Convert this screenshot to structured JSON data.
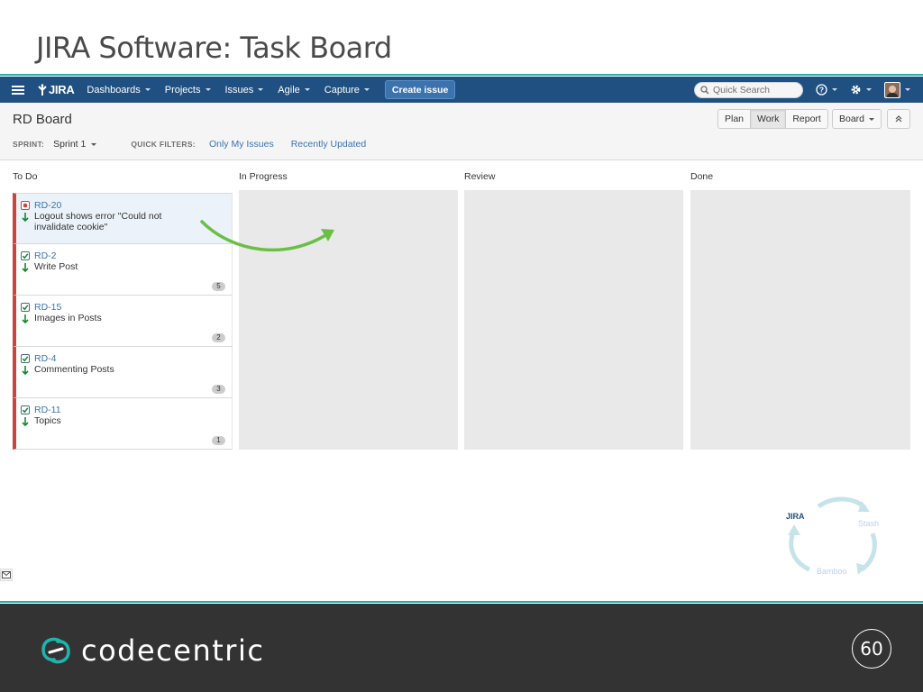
{
  "slide": {
    "title": "JIRA Software: Task Board",
    "page_number": "60",
    "footer_brand": "codecentric"
  },
  "nav": {
    "logo": "JIRA",
    "menu": [
      {
        "label": "Dashboards"
      },
      {
        "label": "Projects"
      },
      {
        "label": "Issues"
      },
      {
        "label": "Agile"
      },
      {
        "label": "Capture"
      }
    ],
    "create_label": "Create issue",
    "search_placeholder": "Quick Search"
  },
  "board": {
    "title": "RD Board",
    "sprint_label": "SPRINT:",
    "sprint_value": "Sprint 1",
    "quick_filters_label": "QUICK FILTERS:",
    "quick_filters": [
      "Only My Issues",
      "Recently Updated"
    ],
    "modes": [
      "Plan",
      "Work",
      "Report"
    ],
    "active_mode": "Work",
    "board_menu": "Board"
  },
  "columns": [
    {
      "name": "To Do"
    },
    {
      "name": "In Progress"
    },
    {
      "name": "Review"
    },
    {
      "name": "Done"
    }
  ],
  "issues": [
    {
      "key": "RD-20",
      "summary": "Logout shows error \"Could not invalidate cookie\"",
      "type": "bug",
      "priority": "low",
      "points": "",
      "selected": true
    },
    {
      "key": "RD-2",
      "summary": "Write Post",
      "type": "task",
      "priority": "low",
      "points": "5"
    },
    {
      "key": "RD-15",
      "summary": "Images in Posts",
      "type": "task",
      "priority": "low",
      "points": "2"
    },
    {
      "key": "RD-4",
      "summary": "Commenting Posts",
      "type": "task",
      "priority": "low",
      "points": "3"
    },
    {
      "key": "RD-11",
      "summary": "Topics",
      "type": "task",
      "priority": "low",
      "points": "1"
    }
  ],
  "graphic": {
    "labels": [
      "JIRA",
      "Stash",
      "Bamboo"
    ]
  },
  "colors": {
    "nav": "#205081",
    "accent": "#1fb5ad",
    "link": "#3b73af",
    "flag": "#d04437",
    "drag_arrow": "#6bbf45"
  }
}
